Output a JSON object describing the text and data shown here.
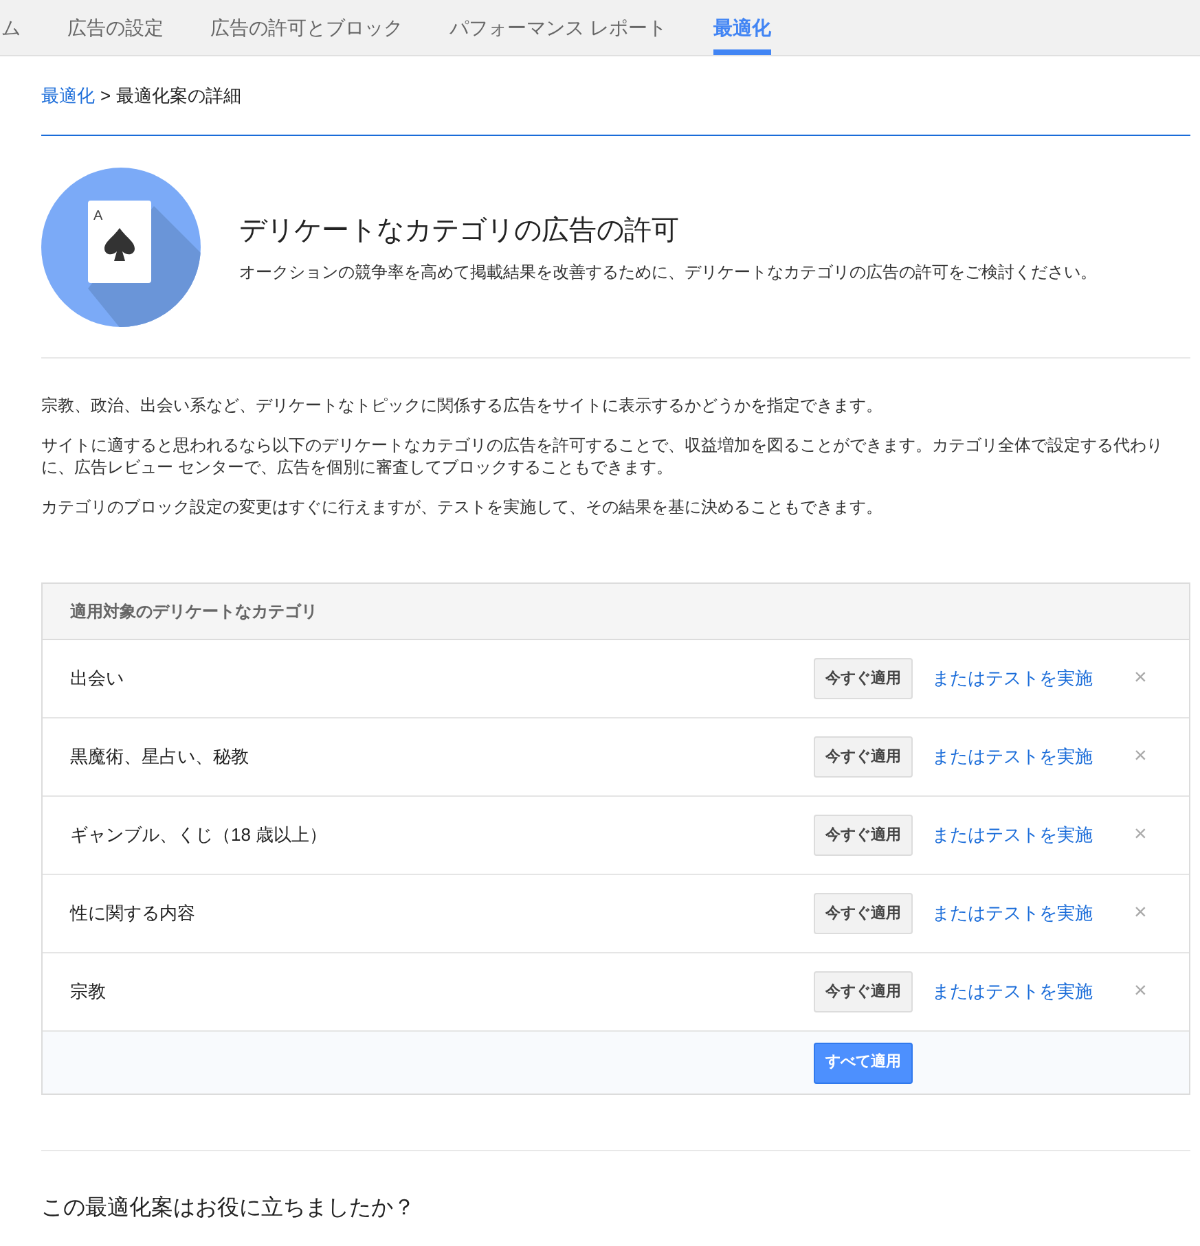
{
  "tabs": [
    {
      "label": "ム",
      "selected": false
    },
    {
      "label": "広告の設定",
      "selected": false
    },
    {
      "label": "広告の許可とブロック",
      "selected": false
    },
    {
      "label": "パフォーマンス レポート",
      "selected": false
    },
    {
      "label": "最適化",
      "selected": true
    }
  ],
  "breadcrumb": {
    "link": "最適化",
    "separator": ">",
    "current": "最適化案の詳細"
  },
  "hero": {
    "card_rank": "A",
    "title": "デリケートなカテゴリの広告の許可",
    "subtitle": "オークションの競争率を高めて掲載結果を改善するために、デリケートなカテゴリの広告の許可をご検討ください。"
  },
  "paragraphs": [
    "宗教、政治、出会い系など、デリケートなトピックに関係する広告をサイトに表示するかどうかを指定できます。",
    "サイトに適すると思われるなら以下のデリケートなカテゴリの広告を許可することで、収益増加を図ることができます。カテゴリ全体で設定する代わりに、広告レビュー センターで、広告を個別に審査してブロックすることもできます。",
    "カテゴリのブロック設定の変更はすぐに行えますが、テストを実施して、その結果を基に決めることもできます。"
  ],
  "table": {
    "header": "適用対象のデリケートなカテゴリ",
    "rows": [
      {
        "name": "出会い",
        "apply": "今すぐ適用",
        "test": "またはテストを実施",
        "dismiss": "×"
      },
      {
        "name": "黒魔術、星占い、秘教",
        "apply": "今すぐ適用",
        "test": "またはテストを実施",
        "dismiss": "×"
      },
      {
        "name": "ギャンブル、くじ（18 歳以上）",
        "apply": "今すぐ適用",
        "test": "またはテストを実施",
        "dismiss": "×"
      },
      {
        "name": "性に関する内容",
        "apply": "今すぐ適用",
        "test": "またはテストを実施",
        "dismiss": "×"
      },
      {
        "name": "宗教",
        "apply": "今すぐ適用",
        "test": "またはテストを実施",
        "dismiss": "×"
      }
    ],
    "apply_all": "すべて適用"
  },
  "feedback": {
    "question": "この最適化案はお役に立ちましたか？"
  }
}
